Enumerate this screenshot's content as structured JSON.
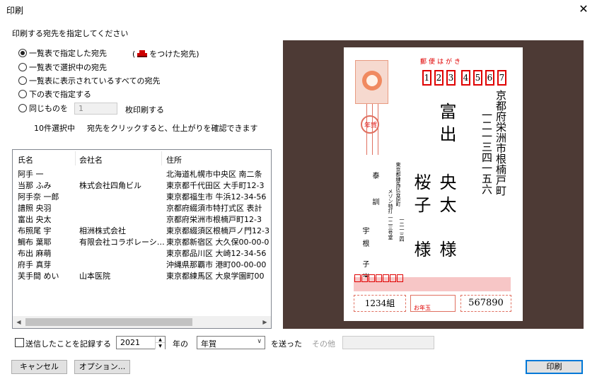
{
  "dialog": {
    "title": "印刷",
    "close_label": "✕"
  },
  "instruction": "印刷する宛先を指定してください",
  "options": [
    {
      "label": "一覧表で指定した宛先",
      "selected": true
    },
    {
      "label": "一覧表で選択中の宛先",
      "selected": false
    },
    {
      "label": "一覧表に表示されているすべての宛先",
      "selected": false
    },
    {
      "label": "下の表で指定する",
      "selected": false
    },
    {
      "label": "同じものを",
      "selected": false
    }
  ],
  "mark_note": {
    "open": "(",
    "icon": "printer-icon",
    "text": "をつけた宛先)"
  },
  "copies": {
    "value": "1",
    "suffix": "枚印刷する"
  },
  "selection_info": "10件選択中",
  "selection_hint": "宛先をクリックすると、仕上がりを確認できます",
  "list": {
    "headers": [
      "氏名",
      "会社名",
      "住所"
    ],
    "rows": [
      {
        "name": "阿手 一",
        "company": "",
        "address": "北海道札幌市中央区 南二条"
      },
      {
        "name": "当那 ふみ",
        "company": "株式会社四角ビル",
        "address": "東京都千代田区 大手町12-3"
      },
      {
        "name": "阿手奈 一郎",
        "company": "",
        "address": "東京都福生市 牛浜12-34-56"
      },
      {
        "name": "譜照 央羽",
        "company": "",
        "address": "京都府綴須市特打式区 表計"
      },
      {
        "name": "富出 央太",
        "company": "",
        "address": "京都府栄洲市根楠戸町12-3"
      },
      {
        "name": "布照尾 宇",
        "company": "相洲株式会社",
        "address": "東京都綴須区根楠戸ノ門12-3"
      },
      {
        "name": "鯛布 葉耶",
        "company": "有限会社コラボレーシ…",
        "address": "東京都新宿区 大久保00-00-0"
      },
      {
        "name": "布出 麻萌",
        "company": "",
        "address": "東京都品川区 大崎12-34-56"
      },
      {
        "name": "府手 真芽",
        "company": "",
        "address": "沖縄県那覇市 港町00-00-00"
      },
      {
        "name": "芙手間 めい",
        "company": "山本医院",
        "address": "東京都練馬区 大泉学園町00"
      }
    ]
  },
  "record": {
    "checked": false,
    "label": "送信したことを記録する",
    "year": "2021",
    "year_unit": "年の",
    "kind": "年賀",
    "sent_label": "を送った",
    "other_label": "その他",
    "other_value": ""
  },
  "buttons": {
    "cancel": "キャンセル",
    "options": "オプション...",
    "print": "印刷"
  },
  "preview": {
    "postcard_header": "郵便はがき",
    "zip_digits": [
      "1",
      "2",
      "3",
      "4",
      "5",
      "6",
      "7"
    ],
    "address_line1": "京都府栄洲市根楠戸町",
    "address_line2": "一二一三四一五六",
    "recipient_family": "富出",
    "recipient_given_1": "央太",
    "recipient_given_2": "桜子",
    "honorific": "様",
    "sender_address_1": "東京都練馬区谷原町",
    "sender_address_2": "メゾン特打 一二三号室",
    "sender_address_num": "一二一三四",
    "sender_name_1": "泰 訓",
    "sender_name_2": "宇根 子米",
    "stamp_text": "年賀",
    "lottery_group": "1234組",
    "lottery_label": "お年玉",
    "lottery_number": "567890",
    "colors": {
      "panel": "#4d3a35",
      "red": "#e00000",
      "pink": "#f7c6c6"
    }
  }
}
